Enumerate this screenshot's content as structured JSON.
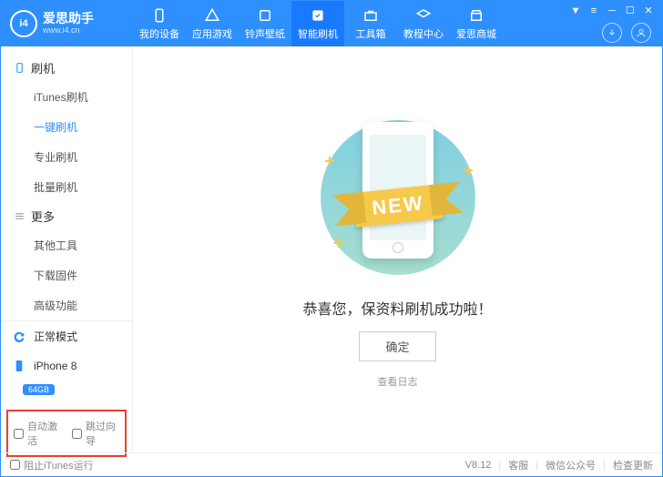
{
  "brand": {
    "logo_text": "i4",
    "title": "爱思助手",
    "subtitle": "www.i4.cn"
  },
  "topnav": [
    {
      "key": "device",
      "label": "我的设备"
    },
    {
      "key": "apps",
      "label": "应用游戏"
    },
    {
      "key": "ringtone",
      "label": "铃声壁纸"
    },
    {
      "key": "flash",
      "label": "智能刷机"
    },
    {
      "key": "toolbox",
      "label": "工具箱"
    },
    {
      "key": "tutorial",
      "label": "教程中心"
    },
    {
      "key": "store",
      "label": "爱思商城"
    }
  ],
  "sidebar": {
    "group1_title": "刷机",
    "group1": [
      {
        "key": "itunes",
        "label": "iTunes刷机"
      },
      {
        "key": "onekey",
        "label": "一键刷机"
      },
      {
        "key": "pro",
        "label": "专业刷机"
      },
      {
        "key": "batch",
        "label": "批量刷机"
      }
    ],
    "group2_title": "更多",
    "group2": [
      {
        "key": "other",
        "label": "其他工具"
      },
      {
        "key": "download",
        "label": "下载固件"
      },
      {
        "key": "advanced",
        "label": "高级功能"
      }
    ],
    "mode_label": "正常模式",
    "device_name": "iPhone 8",
    "device_badge": "64GB",
    "opt_auto_activate": "自动激活",
    "opt_skip_guide": "跳过向导"
  },
  "main": {
    "ribbon": "NEW",
    "success_text": "恭喜您，保资料刷机成功啦！",
    "ok_btn": "确定",
    "log_link": "查看日志"
  },
  "statusbar": {
    "block_itunes": "阻止iTunes运行",
    "version": "V8.12",
    "support": "客服",
    "wechat": "微信公众号",
    "check_update": "检查更新"
  }
}
